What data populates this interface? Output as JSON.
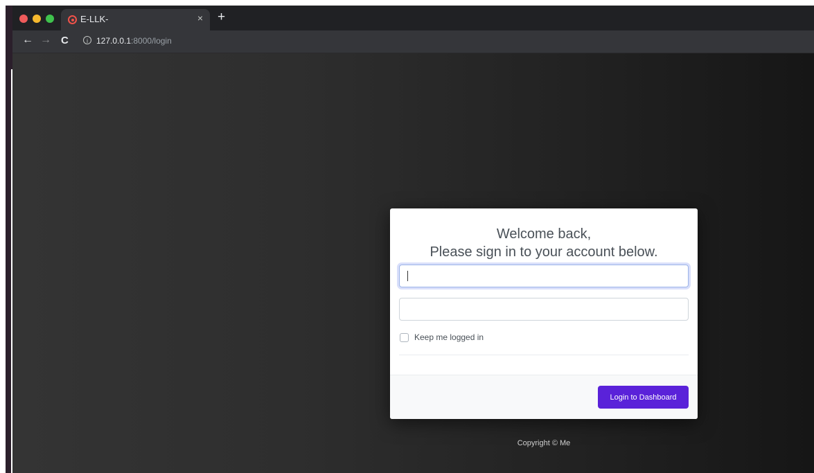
{
  "browser": {
    "tab": {
      "title": "E-LLK-",
      "close_glyph": "×",
      "favicon": "target-icon"
    },
    "new_tab_glyph": "+",
    "nav": {
      "back_glyph": "←",
      "forward_glyph": "→",
      "reload_glyph": "C",
      "info_glyph": "i"
    },
    "url": {
      "host": "127.0.0.1",
      "rest": ":8000/login"
    }
  },
  "login": {
    "title_line1": "Welcome back,",
    "title_line2": "Please sign in to your account below.",
    "email_value": "",
    "password_value": "",
    "remember_label": "Keep me logged in",
    "remember_checked": false,
    "submit_label": "Login to Dashboard",
    "accent_color": "#5a22d9"
  },
  "footer": {
    "copyright": "Copyright © Me"
  }
}
